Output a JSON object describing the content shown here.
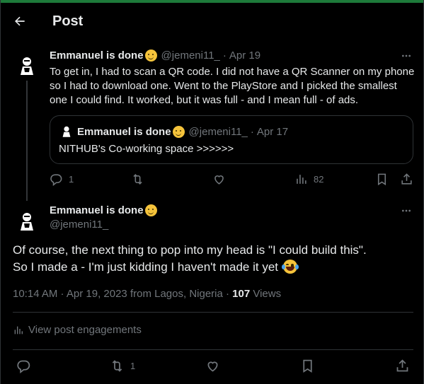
{
  "header": {
    "title": "Post"
  },
  "reply_tweet": {
    "name": "Emmanuel is done",
    "handle": "@jemeni11_",
    "separator": "·",
    "date": "Apr 19",
    "text": "To get in, I had to scan a QR code.  I did not have a QR Scanner on my phone so I had to download one. Went to the PlayStore and I picked the smallest one I could find. It worked, but it was full - and I mean full - of ads.",
    "quote": {
      "name": "Emmanuel is done",
      "handle": "@jemeni11_",
      "separator": "·",
      "date": "Apr 17",
      "text": "NITHUB's Co-working space >>>>>>"
    },
    "actions": {
      "replies": "1",
      "views": "82"
    }
  },
  "main_tweet": {
    "name": "Emmanuel is done",
    "handle": "@jemeni11_",
    "line1": "Of course, the next thing to pop into my head is  \"I could build this\".",
    "line2": "So I made a - I'm just kidding I haven't made it yet",
    "meta_time": "10:14 AM · Apr 19, 2023 from Lagos, Nigeria · ",
    "views_count": "107",
    "views_label": " Views",
    "engagements_label": "View post engagements",
    "actions": {
      "retweets": "1"
    }
  },
  "icons": {
    "back": "arrow-left-icon",
    "more": "more-horizontal-icon",
    "reply": "reply-icon",
    "retweet": "retweet-icon",
    "like": "heart-icon",
    "views": "bar-chart-icon",
    "bookmark": "bookmark-icon",
    "share": "share-icon"
  },
  "colors": {
    "background": "#000000",
    "text": "#e7e9ea",
    "muted": "#71767b",
    "border": "#2f3336",
    "accent_bar": "#1d7a3a"
  }
}
